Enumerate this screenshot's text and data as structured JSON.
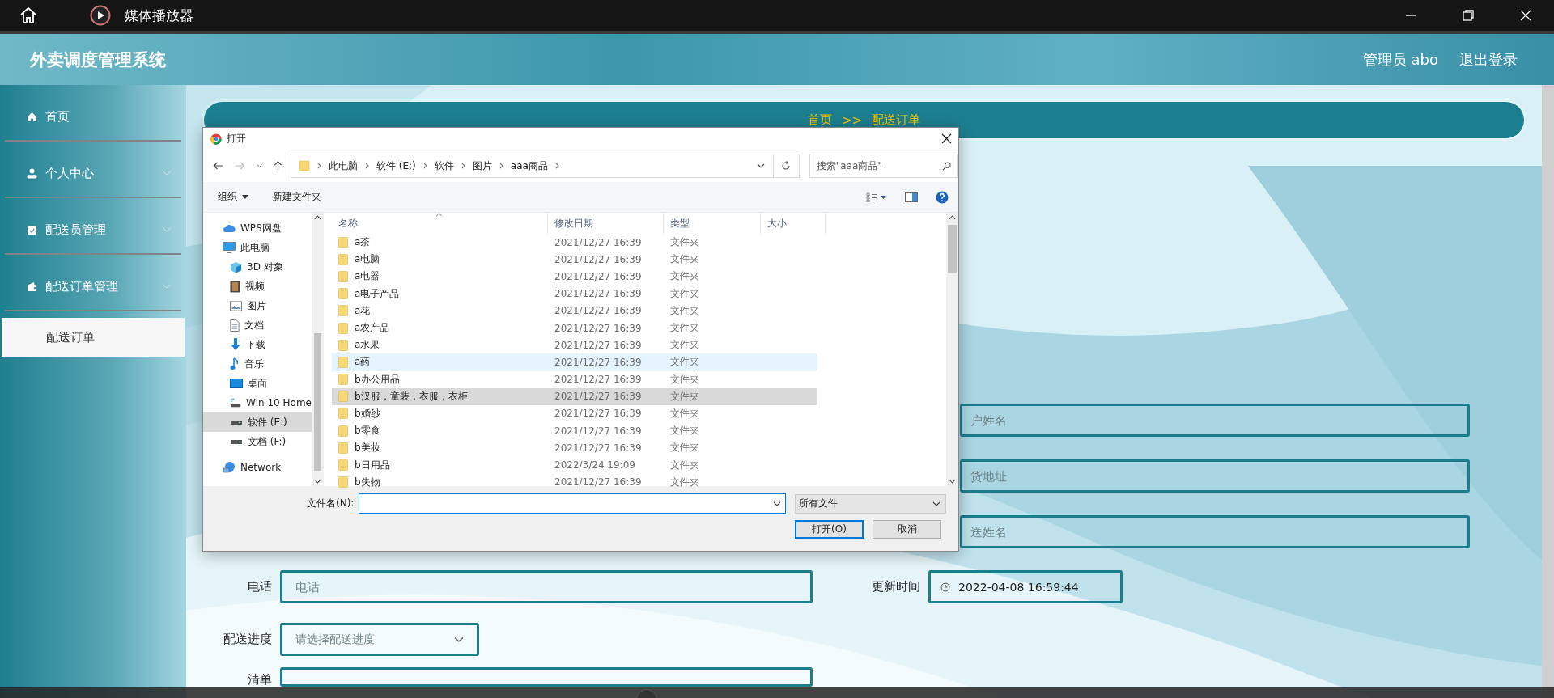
{
  "window": {
    "title": "媒体播放器"
  },
  "header": {
    "app_title": "外卖调度管理系统",
    "user": "管理员 abo",
    "logout": "退出登录"
  },
  "sidebar": {
    "items": [
      {
        "label": "首页",
        "expandable": false
      },
      {
        "label": "个人中心",
        "expandable": true
      },
      {
        "label": "配送员管理",
        "expandable": true
      },
      {
        "label": "配送订单管理",
        "expandable": true,
        "children": [
          {
            "label": "配送订单",
            "selected": true
          }
        ]
      }
    ]
  },
  "breadcrumb": [
    "首页",
    ">>",
    "配送订单"
  ],
  "form": {
    "upper_fields": [
      {
        "placeholder": "户姓名"
      },
      {
        "placeholder": "货地址"
      },
      {
        "placeholder": "送姓名"
      }
    ],
    "phone": {
      "label": "电话",
      "placeholder": "电话"
    },
    "updated": {
      "label": "更新时间",
      "value": "2022-04-08 16:59:44"
    },
    "progress": {
      "label": "配送进度",
      "placeholder": "请选择配送进度"
    },
    "list": {
      "label": "清单"
    }
  },
  "dialog": {
    "title": "打开",
    "path": [
      "此电脑",
      "软件 (E:)",
      "软件",
      "图片",
      "aaa商品"
    ],
    "search": {
      "placeholder": "搜索\"aaa商品\""
    },
    "toolbar": {
      "organize": "组织",
      "new_folder": "新建文件夹"
    },
    "nav": [
      {
        "label": "WPS网盘",
        "selected": false
      },
      {
        "label": "此电脑",
        "selected": false,
        "children": [
          {
            "label": "3D 对象",
            "selected": false
          },
          {
            "label": "视频",
            "selected": false
          },
          {
            "label": "图片",
            "selected": false
          },
          {
            "label": "文档",
            "selected": false
          },
          {
            "label": "下载",
            "selected": false
          },
          {
            "label": "音乐",
            "selected": false
          },
          {
            "label": "桌面",
            "selected": false
          },
          {
            "label": "Win 10 Home",
            "selected": false
          },
          {
            "label": "软件 (E:)",
            "selected": true
          },
          {
            "label": "文档 (F:)",
            "selected": false
          }
        ]
      },
      {
        "label": "Network",
        "selected": false
      }
    ],
    "columns": [
      "名称",
      "修改日期",
      "类型",
      "大小"
    ],
    "rows": [
      {
        "name": "a茶",
        "date": "2021/12/27 16:39",
        "type": "文件夹",
        "selected": false,
        "hovered": false
      },
      {
        "name": "a电脑",
        "date": "2021/12/27 16:39",
        "type": "文件夹",
        "selected": false,
        "hovered": false
      },
      {
        "name": "a电器",
        "date": "2021/12/27 16:39",
        "type": "文件夹",
        "selected": false,
        "hovered": false
      },
      {
        "name": "a电子产品",
        "date": "2021/12/27 16:39",
        "type": "文件夹",
        "selected": false,
        "hovered": false
      },
      {
        "name": "a花",
        "date": "2021/12/27 16:39",
        "type": "文件夹",
        "selected": false,
        "hovered": false
      },
      {
        "name": "a农产品",
        "date": "2021/12/27 16:39",
        "type": "文件夹",
        "selected": false,
        "hovered": false
      },
      {
        "name": "a水果",
        "date": "2021/12/27 16:39",
        "type": "文件夹",
        "selected": false,
        "hovered": false
      },
      {
        "name": "a药",
        "date": "2021/12/27 16:39",
        "type": "文件夹",
        "selected": false,
        "hovered": true
      },
      {
        "name": "b办公用品",
        "date": "2021/12/27 16:39",
        "type": "文件夹",
        "selected": false,
        "hovered": false
      },
      {
        "name": "b汉服，童装，衣服，衣柜",
        "date": "2021/12/27 16:39",
        "type": "文件夹",
        "selected": true,
        "hovered": false
      },
      {
        "name": "b婚纱",
        "date": "2021/12/27 16:39",
        "type": "文件夹",
        "selected": false,
        "hovered": false
      },
      {
        "name": "b零食",
        "date": "2021/12/27 16:39",
        "type": "文件夹",
        "selected": false,
        "hovered": false
      },
      {
        "name": "b美妆",
        "date": "2021/12/27 16:39",
        "type": "文件夹",
        "selected": false,
        "hovered": false
      },
      {
        "name": "b日用品",
        "date": "2022/3/24 19:09",
        "type": "文件夹",
        "selected": false,
        "hovered": false
      },
      {
        "name": "b失物",
        "date": "2021/12/27 16:39",
        "type": "文件夹",
        "selected": false,
        "hovered": false
      }
    ],
    "filename_label": "文件名(N):",
    "filetype": "所有文件",
    "open_button": "打开(O)",
    "cancel_button": "取消"
  }
}
